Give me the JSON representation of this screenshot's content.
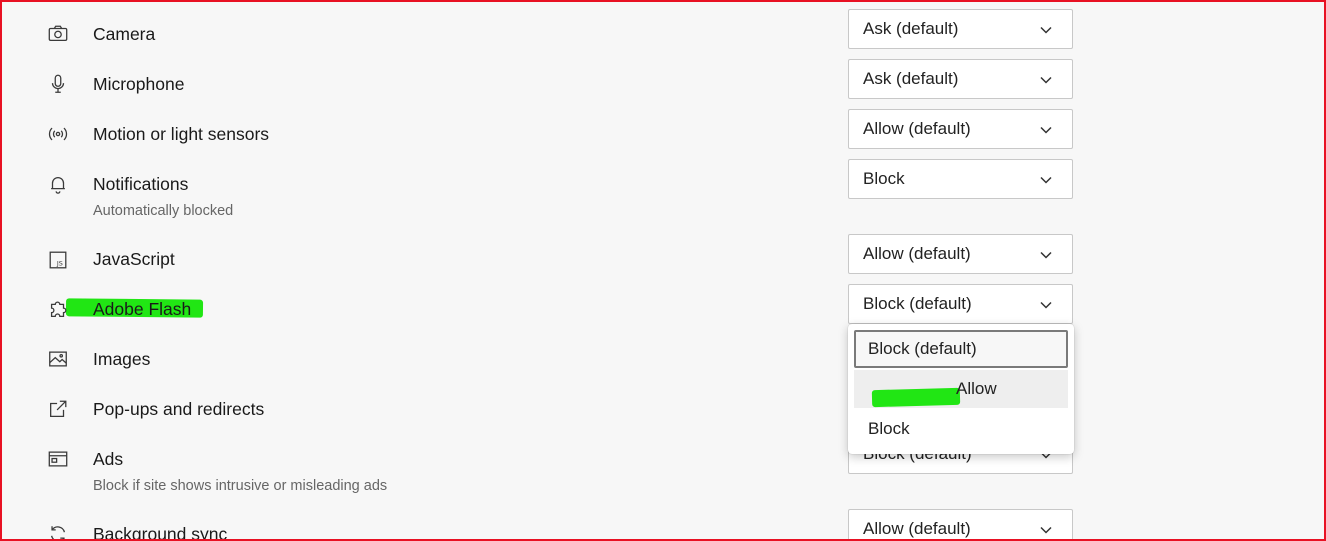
{
  "settings": [
    {
      "label": "Camera",
      "icon": "camera-icon",
      "value": "Ask (default)"
    },
    {
      "label": "Microphone",
      "icon": "microphone-icon",
      "value": "Ask (default)"
    },
    {
      "label": "Motion or light sensors",
      "icon": "sensors-icon",
      "value": "Allow (default)"
    },
    {
      "label": "Notifications",
      "icon": "bell-icon",
      "value": "Block",
      "sub": "Automatically blocked"
    },
    {
      "label": "JavaScript",
      "icon": "javascript-icon",
      "value": "Allow (default)"
    },
    {
      "label": "Adobe Flash",
      "icon": "puzzle-icon",
      "value": "Block (default)"
    },
    {
      "label": "Images",
      "icon": "image-icon"
    },
    {
      "label": "Pop-ups and redirects",
      "icon": "external-link-icon"
    },
    {
      "label": "Ads",
      "icon": "ads-icon",
      "value": "Block (default)",
      "sub": "Block if site shows intrusive or misleading ads"
    },
    {
      "label": "Background sync",
      "icon": "sync-icon",
      "value": "Allow (default)"
    }
  ],
  "flash_dropdown": {
    "options": [
      "Block (default)",
      "Allow",
      "Block"
    ],
    "selected": "Block (default)",
    "hovered": "Allow"
  },
  "colors": {
    "highlight": "#21e614",
    "frame": "#e81123"
  }
}
